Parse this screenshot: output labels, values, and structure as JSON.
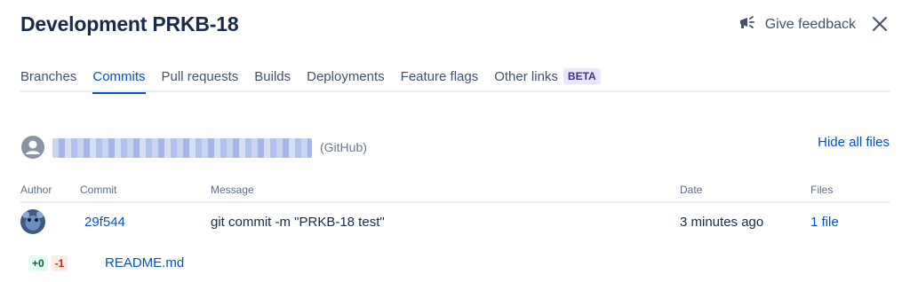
{
  "header": {
    "title": "Development PRKB-18",
    "feedback_label": "Give feedback"
  },
  "tabs": [
    {
      "label": "Branches",
      "active": false
    },
    {
      "label": "Commits",
      "active": true
    },
    {
      "label": "Pull requests",
      "active": false
    },
    {
      "label": "Builds",
      "active": false
    },
    {
      "label": "Deployments",
      "active": false
    },
    {
      "label": "Feature flags",
      "active": false
    },
    {
      "label": "Other links",
      "active": false,
      "badge": "BETA"
    }
  ],
  "repository": {
    "source": "(GitHub)",
    "hide_files_label": "Hide all files"
  },
  "table": {
    "headers": {
      "author": "Author",
      "commit": "Commit",
      "message": "Message",
      "date": "Date",
      "files": "Files"
    },
    "rows": [
      {
        "commit": "29f544",
        "message": "git commit -m \"PRKB-18 test\"",
        "date": "3 minutes ago",
        "files": "1 file"
      }
    ]
  },
  "file_changes": [
    {
      "added": "+0",
      "removed": "-1",
      "name": "README.md"
    }
  ],
  "colors": {
    "link": "#0052cc",
    "text": "#172b4d",
    "muted": "#6b778c",
    "beta_bg": "#eae6ff",
    "added_bg": "#e3fcef",
    "removed_bg": "#ffebe6"
  },
  "icons": {
    "feedback": "megaphone-icon",
    "close": "close-icon",
    "user": "user-avatar-icon"
  }
}
